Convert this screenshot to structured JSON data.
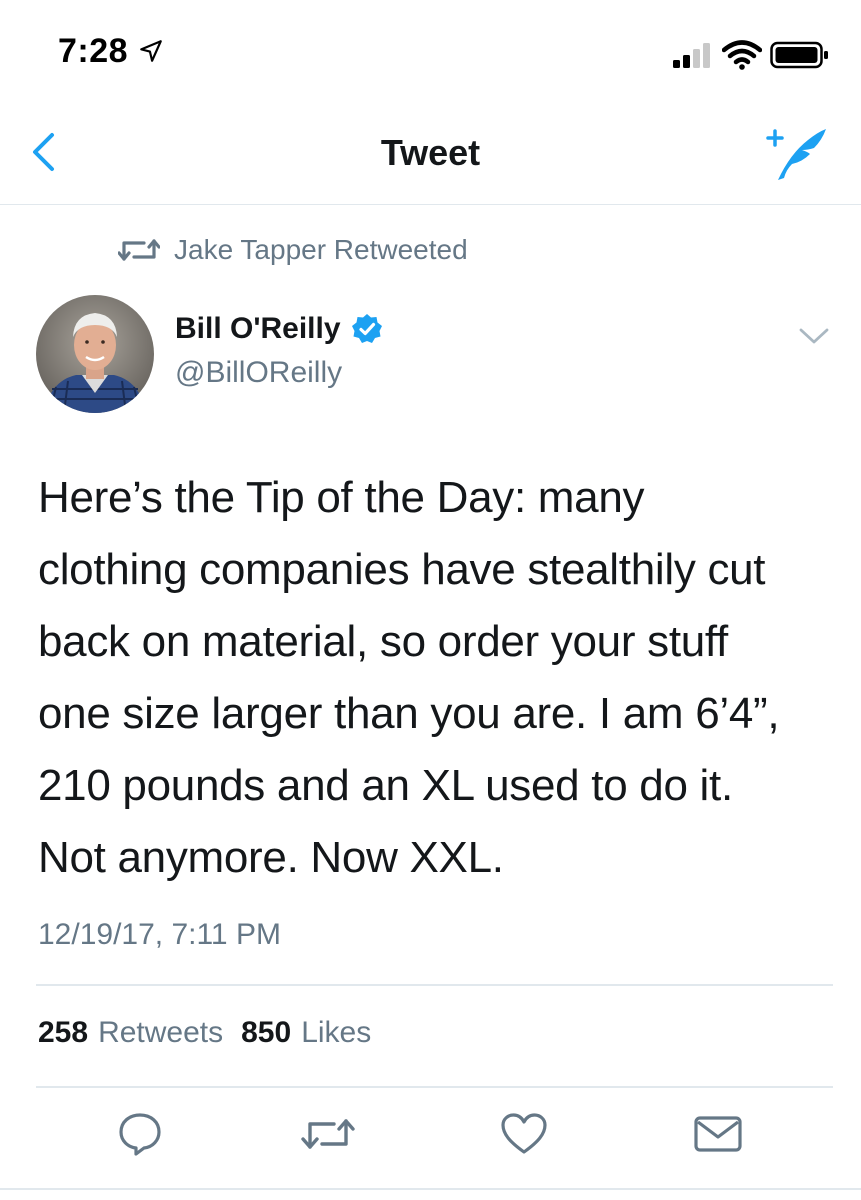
{
  "status_bar": {
    "time": "7:28"
  },
  "nav": {
    "title": "Tweet"
  },
  "retweet": {
    "text": "Jake Tapper Retweeted"
  },
  "author": {
    "name": "Bill O'Reilly",
    "handle": "@BillOReilly"
  },
  "tweet": {
    "text": "Here’s the Tip of the Day: many\nclothing companies have stealthily cut\nback on material, so order your stuff\none size larger than you are. I am 6’4”,\n210 pounds and an XL used to do it.\nNot anymore. Now XXL.",
    "timestamp": "12/19/17, 7:11 PM"
  },
  "stats": {
    "retweets_count": "258",
    "retweets_label": "Retweets",
    "likes_count": "850",
    "likes_label": "Likes"
  },
  "colors": {
    "accent": "#1da1f2",
    "muted": "#657786",
    "text": "#14171a",
    "divider": "#e1e8ed"
  },
  "icons": [
    "back-chevron-icon",
    "compose-tweet-icon",
    "retweet-icon",
    "verified-badge-icon",
    "caret-down-icon",
    "reply-icon",
    "like-icon",
    "share-icon"
  ]
}
